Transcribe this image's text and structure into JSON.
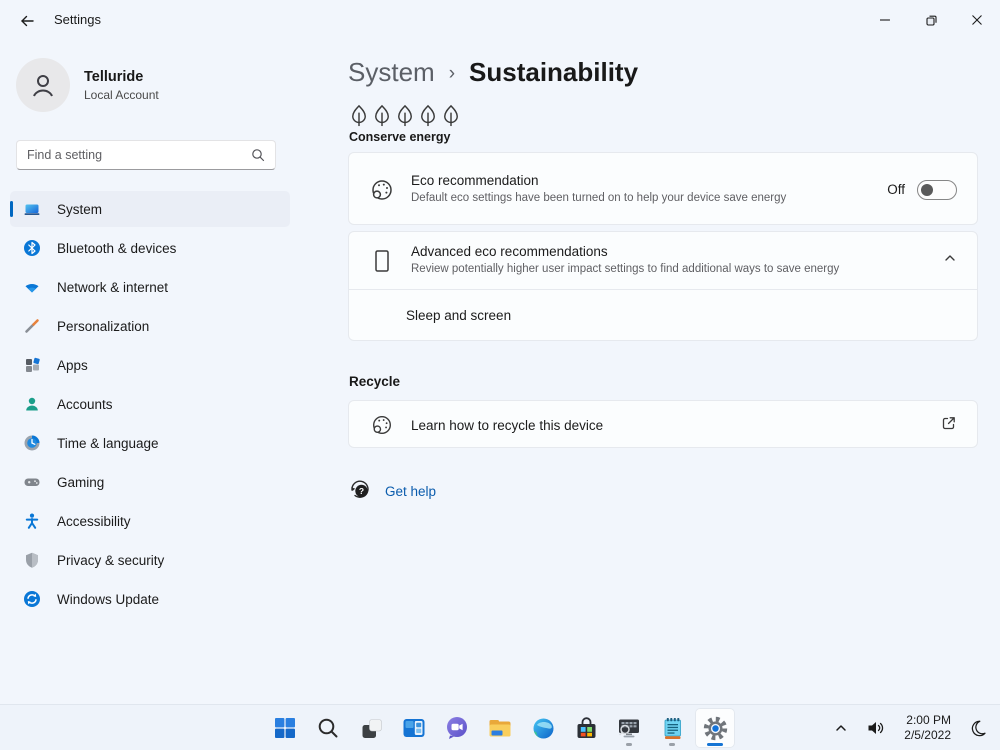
{
  "titlebar": {
    "title": "Settings"
  },
  "user": {
    "name": "Telluride",
    "type": "Local Account"
  },
  "search": {
    "placeholder": "Find a setting"
  },
  "sidebar": {
    "items": [
      {
        "label": "System",
        "icon": "laptop-icon",
        "selected": true
      },
      {
        "label": "Bluetooth & devices",
        "icon": "bluetooth-icon",
        "selected": false
      },
      {
        "label": "Network & internet",
        "icon": "wifi-icon",
        "selected": false
      },
      {
        "label": "Personalization",
        "icon": "brush-icon",
        "selected": false
      },
      {
        "label": "Apps",
        "icon": "apps-grid-icon",
        "selected": false
      },
      {
        "label": "Accounts",
        "icon": "person-icon",
        "selected": false
      },
      {
        "label": "Time & language",
        "icon": "clock-icon",
        "selected": false
      },
      {
        "label": "Gaming",
        "icon": "gamepad-icon",
        "selected": false
      },
      {
        "label": "Accessibility",
        "icon": "accessibility-icon",
        "selected": false
      },
      {
        "label": "Privacy & security",
        "icon": "shield-icon",
        "selected": false
      },
      {
        "label": "Windows Update",
        "icon": "update-icon",
        "selected": false
      }
    ]
  },
  "main": {
    "breadcrumb": {
      "parent": "System",
      "separator": "›",
      "current": "Sustainability"
    },
    "conserve": {
      "label": "Conserve energy",
      "leaf_count": 5
    },
    "eco_card": {
      "title": "Eco recommendation",
      "subtitle": "Default eco settings have been turned on to help your device save energy",
      "toggle_label": "Off",
      "toggle_state": "off"
    },
    "advanced_card": {
      "title": "Advanced eco recommendations",
      "subtitle": "Review potentially higher user impact settings to find additional ways to save energy",
      "expanded": true,
      "sub_item": "Sleep and screen"
    },
    "recycle_section": {
      "header": "Recycle",
      "link_label": "Learn how to recycle this device"
    },
    "get_help": {
      "label": "Get help"
    }
  },
  "taskbar": {
    "apps": [
      {
        "name": "start",
        "running": false,
        "active": false
      },
      {
        "name": "search",
        "running": false,
        "active": false
      },
      {
        "name": "task-view",
        "running": false,
        "active": false
      },
      {
        "name": "widgets",
        "running": false,
        "active": false
      },
      {
        "name": "chat",
        "running": false,
        "active": false
      },
      {
        "name": "file-explorer",
        "running": false,
        "active": false
      },
      {
        "name": "edge",
        "running": false,
        "active": false
      },
      {
        "name": "microsoft-store",
        "running": false,
        "active": false
      },
      {
        "name": "system-monitor-app",
        "running": true,
        "active": false
      },
      {
        "name": "notepad-app",
        "running": true,
        "active": false
      },
      {
        "name": "settings",
        "running": true,
        "active": true
      }
    ],
    "tray": {
      "time": "2:00 PM",
      "date": "2/5/2022"
    }
  },
  "colors": {
    "accent": "#0067c0",
    "link": "#0b5cad",
    "background": "#f2f6fc",
    "card": "#fbfdfe",
    "taskbar": "#eef3fa",
    "toggle_knob": "#5a5a5a"
  }
}
